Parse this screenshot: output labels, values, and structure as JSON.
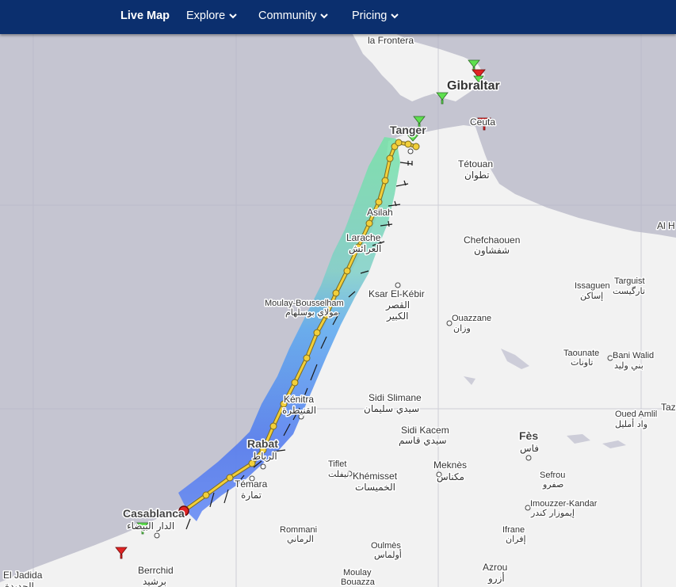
{
  "nav": {
    "items": [
      {
        "label": "Live Map",
        "active": true,
        "dropdown": false
      },
      {
        "label": "Explore",
        "active": false,
        "dropdown": true
      },
      {
        "label": "Community",
        "active": false,
        "dropdown": true
      },
      {
        "label": "Pricing",
        "active": false,
        "dropdown": true
      }
    ]
  },
  "colors": {
    "nav_bg": "#0b2f6e",
    "sea": "#c5c5d1",
    "land": "#f2f2f2",
    "track": "#f2cf3a",
    "start_marker": "#e02424",
    "station_green": "#5ee04f",
    "station_red": "#e02424"
  },
  "places": {
    "la_frontera": "la Frontera",
    "gibraltar": "Gibraltar",
    "tanger": "Tanger",
    "ceuta": "Ceuta",
    "tetouan": "Tétouan",
    "tetouan_ar": "تطوان",
    "asilah": "Asilah",
    "larache": "Larache",
    "larache_ar": "العرائش",
    "chefchaouen": "Chefchaouen",
    "chefchaouen_ar": "شفشاون",
    "al_hoceima": "Al H",
    "issaguen": "Issaguen",
    "issaguen_ar": "إساكن",
    "targuist": "Targuist",
    "targuist_ar": "تارگيست",
    "ksar_el_kebir": "Ksar El-Kébir",
    "ksar_el_kebir_ar1": "القصر",
    "ksar_el_kebir_ar2": "الكبير",
    "moulay_bousselham": "Moulay-Bousselham",
    "moulay_bousselham_ar": "مولاي بوسلهام",
    "ouazzane": "Ouazzane",
    "ouazzane_ar": "وزان",
    "taounate": "Taounate",
    "taounate_ar": "تاونات",
    "bani_walid": "Bani Walid",
    "bani_walid_ar": "بني وليد",
    "kenitra": "Kénitra",
    "kenitra_ar": "القنيطرة",
    "sidi_slimane": "Sidi Slimane",
    "sidi_slimane_ar": "سيدي سليمان",
    "sidi_kacem": "Sidi Kacem",
    "sidi_kacem_ar": "سيدي قاسم",
    "oued_amlil": "Oued Amlil",
    "oued_amlil_ar": "واد أمليل",
    "taza": "Taz",
    "rabat": "Rabat",
    "rabat_ar": "الرباط",
    "temara": "Témara",
    "temara_ar": "تمارة",
    "tiflet": "Tiflet",
    "tiflet_ar": "تيفلت",
    "khemisset": "Khémisset",
    "khemisset_ar": "الخميسات",
    "meknes": "Meknès",
    "meknes_ar": "مكناس",
    "fes": "Fès",
    "fes_ar": "فاس",
    "sefrou": "Sefrou",
    "sefrou_ar": "صفرو",
    "imouzzer": "Imouzzer-Kandar",
    "imouzzer_ar": "إيموزار كندر",
    "casablanca": "Casablanca",
    "casablanca_ar": "الدار البيضاء",
    "rommani": "Rommani",
    "rommani_ar": "الرماني",
    "oulmes": "Oulmès",
    "oulmes_ar": "أولماس",
    "ifrane": "Ifrane",
    "ifrane_ar": "إفران",
    "azrou": "Azrou",
    "azrou_ar": "أزرو",
    "berrchid": "Berrchid",
    "berrchid_ar": "برشيد",
    "moulay_bouazza1": "Moulay",
    "moulay_bouazza2": "Bouazza",
    "el_jadida": "El Jadida",
    "el_jadida_ar": "الجديدة"
  }
}
